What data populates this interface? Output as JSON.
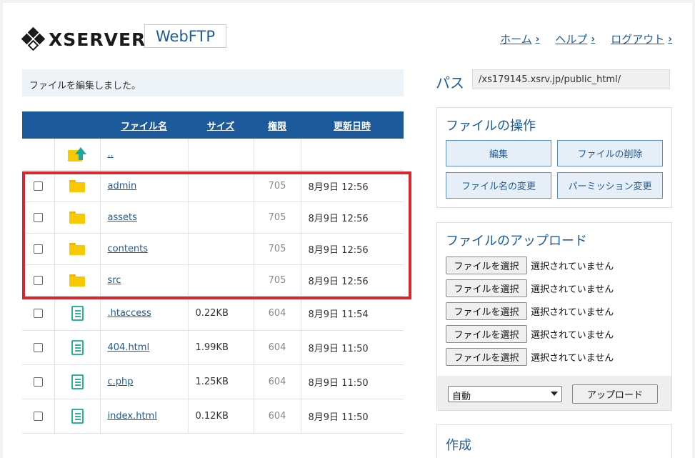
{
  "header": {
    "logo_text": "XSERVER",
    "app_name": "WebFTP",
    "nav": [
      {
        "label": "ホーム"
      },
      {
        "label": "ヘルプ"
      },
      {
        "label": "ログアウト"
      }
    ]
  },
  "message": "ファイルを編集しました。",
  "table": {
    "headers": {
      "name": "ファイル名",
      "size": "サイズ",
      "perm": "権限",
      "date": "更新日時"
    },
    "parent": "..",
    "rows": [
      {
        "type": "folder",
        "name": "admin",
        "size": "",
        "perm": "705",
        "date": "8月9日 12:56"
      },
      {
        "type": "folder",
        "name": "assets",
        "size": "",
        "perm": "705",
        "date": "8月9日 12:56"
      },
      {
        "type": "folder",
        "name": "contents",
        "size": "",
        "perm": "705",
        "date": "8月9日 12:56"
      },
      {
        "type": "folder",
        "name": "src",
        "size": "",
        "perm": "705",
        "date": "8月9日 12:56"
      },
      {
        "type": "file",
        "name": ".htaccess",
        "size": "0.22KB",
        "perm": "604",
        "date": "8月9日 11:54"
      },
      {
        "type": "file",
        "name": "404.html",
        "size": "1.99KB",
        "perm": "604",
        "date": "8月9日 11:50"
      },
      {
        "type": "file",
        "name": "c.php",
        "size": "1.25KB",
        "perm": "604",
        "date": "8月9日 11:50"
      },
      {
        "type": "file",
        "name": "index.html",
        "size": "0.12KB",
        "perm": "604",
        "date": "8月9日 11:50"
      }
    ]
  },
  "path": {
    "label": "パス",
    "value": "/xs179145.xsrv.jp/public_html/"
  },
  "ops": {
    "title": "ファイルの操作",
    "edit": "編集",
    "delete": "ファイルの削除",
    "rename": "ファイル名の変更",
    "permission": "パーミッション変更"
  },
  "upload": {
    "title": "ファイルのアップロード",
    "choose_label": "ファイルを選択",
    "no_file": "選択されていません",
    "mode": "自動",
    "submit": "アップロード"
  },
  "create": {
    "title": "作成"
  },
  "colors": {
    "brand": "#1d5a9c",
    "highlight": "#d9262f",
    "folder": "#f8c800",
    "file": "#2bb0a2"
  }
}
